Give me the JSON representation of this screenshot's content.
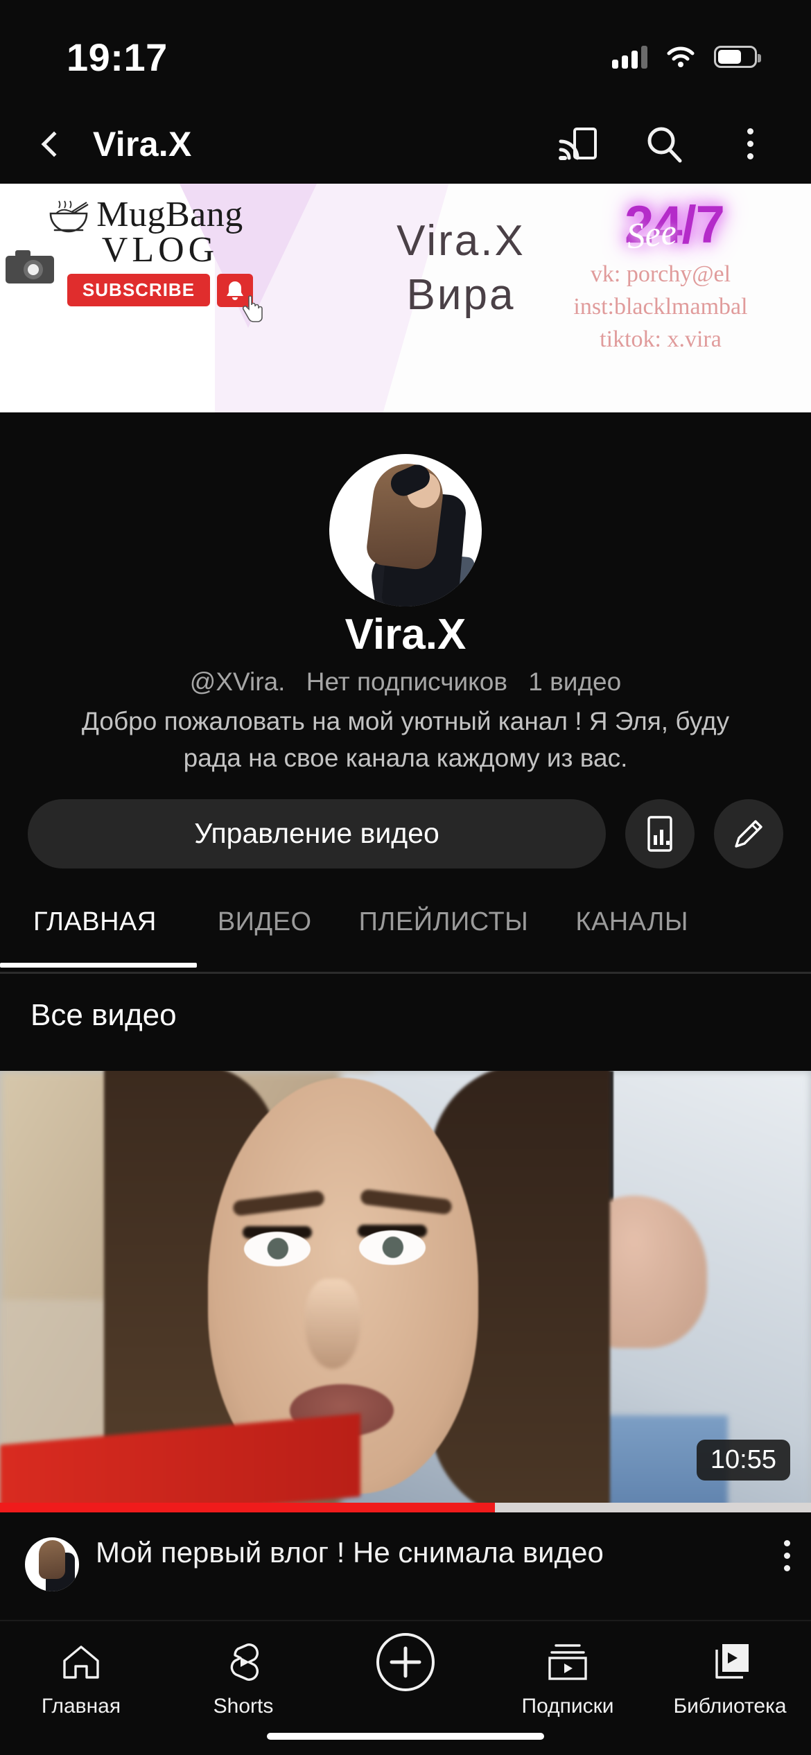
{
  "status_bar": {
    "time": "19:17",
    "icons": [
      "cellular-signal-icon",
      "wifi-icon",
      "battery-icon"
    ]
  },
  "app_bar": {
    "back_icon": "back-chevron-icon",
    "title": "Vira.X",
    "cast_icon": "cast-icon",
    "search_icon": "search-icon",
    "more_icon": "more-vertical-icon"
  },
  "banner": {
    "brand_title": "MugBang",
    "brand_subtitle": "VLOG",
    "subscribe_label": "SUBSCRIBE",
    "bell_icon": "bell-icon",
    "hand_cursor_icon": "hand-cursor-icon",
    "bowl_icon": "noodle-bowl-icon",
    "camera_icon": "camera-icon",
    "watermark_latin": "Vira.X",
    "watermark_cyrillic": "Вира",
    "neon_text": "24/7",
    "neon_script": "See",
    "socials": [
      "vk: porchy@el",
      "inst:blacklmambal",
      "tiktok: x.vira"
    ],
    "accent_purple": "#b42bc9",
    "accent_pink": "#e09b9b",
    "subscribe_red": "#e02d2d"
  },
  "channel": {
    "avatar_name": "channel-avatar",
    "name": "Vira.X",
    "handle": "@XVira.",
    "subscribers": "Нет подписчиков",
    "video_count": "1 видео",
    "description_line_1": "Добро пожаловать на мой уютный канал ! Я Эля, буду",
    "description_line_2": "рада на свое канала каждому из вас.",
    "expand_icon": "chevron-right-icon"
  },
  "actions": {
    "manage_label": "Управление видео",
    "analytics_icon": "analytics-bar-chart-icon",
    "edit_icon": "pencil-edit-icon"
  },
  "tabs": [
    {
      "label": "ГЛАВНАЯ",
      "active": true
    },
    {
      "label": "ВИДЕО",
      "active": false
    },
    {
      "label": "ПЛЕЙЛИСТЫ",
      "active": false
    },
    {
      "label": "КАНАЛЫ",
      "active": false
    }
  ],
  "section": {
    "title": "Все видео"
  },
  "video": {
    "thumbnail_name": "video-thumbnail",
    "duration": "10:55",
    "progress_percent": 61,
    "progress_color": "#f01b1b",
    "title": "Мой первый влог ! Не снимала видео",
    "menu_icon": "more-vertical-icon"
  },
  "bottom_nav": [
    {
      "label": "Главная",
      "icon": "home-icon"
    },
    {
      "label": "Shorts",
      "icon": "shorts-icon"
    },
    {
      "label": "",
      "icon": "create-plus-icon"
    },
    {
      "label": "Подписки",
      "icon": "subscriptions-icon"
    },
    {
      "label": "Библиотека",
      "icon": "library-icon"
    }
  ]
}
